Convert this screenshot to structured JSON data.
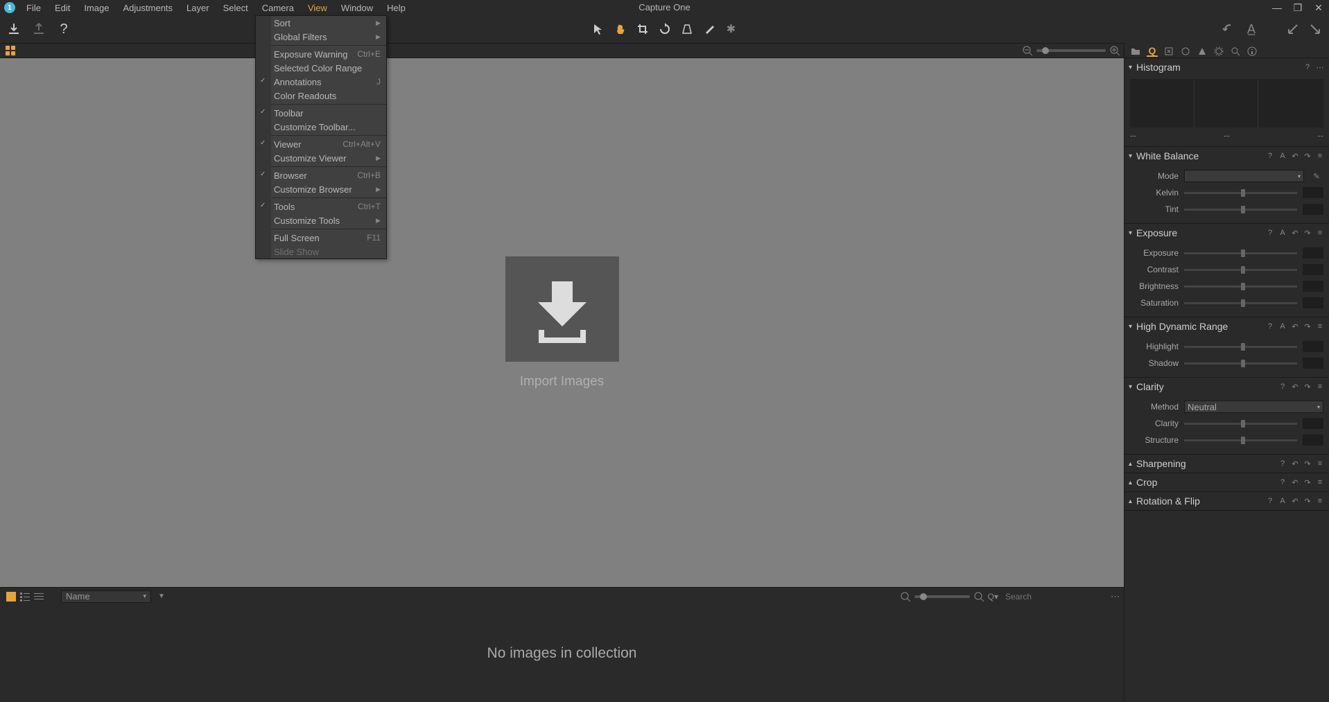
{
  "app": {
    "title": "Capture One"
  },
  "menubar": [
    "File",
    "Edit",
    "Image",
    "Adjustments",
    "Layer",
    "Select",
    "Camera",
    "View",
    "Window",
    "Help"
  ],
  "menubar_active": "View",
  "view_menu": [
    {
      "label": "Sort",
      "arrow": true
    },
    {
      "label": "Global Filters",
      "arrow": true
    },
    {
      "sep": true
    },
    {
      "label": "Exposure Warning",
      "shortcut": "Ctrl+E"
    },
    {
      "label": "Selected Color Range"
    },
    {
      "label": "Annotations",
      "shortcut": "J",
      "checked": true
    },
    {
      "label": "Color Readouts"
    },
    {
      "sep": true
    },
    {
      "label": "Toolbar",
      "checked": true
    },
    {
      "label": "Customize Toolbar..."
    },
    {
      "sep": true
    },
    {
      "label": "Viewer",
      "shortcut": "Ctrl+Alt+V",
      "checked": true
    },
    {
      "label": "Customize Viewer",
      "arrow": true
    },
    {
      "sep": true
    },
    {
      "label": "Browser",
      "shortcut": "Ctrl+B",
      "checked": true
    },
    {
      "label": "Customize Browser",
      "arrow": true
    },
    {
      "sep": true
    },
    {
      "label": "Tools",
      "shortcut": "Ctrl+T",
      "checked": true
    },
    {
      "label": "Customize Tools",
      "arrow": true
    },
    {
      "sep": true
    },
    {
      "label": "Full Screen",
      "shortcut": "F11"
    },
    {
      "label": "Slide Show",
      "disabled": true
    }
  ],
  "viewer": {
    "import_label": "Import Images"
  },
  "browser": {
    "sort_by": "Name",
    "search_placeholder": "Search",
    "empty": "No images in collection"
  },
  "panels": {
    "histogram": {
      "title": "Histogram",
      "v1": "--",
      "v2": "--",
      "v3": "--"
    },
    "white_balance": {
      "title": "White Balance",
      "mode": "Mode",
      "kelvin": "Kelvin",
      "tint": "Tint"
    },
    "exposure": {
      "title": "Exposure",
      "exposure": "Exposure",
      "contrast": "Contrast",
      "brightness": "Brightness",
      "saturation": "Saturation"
    },
    "hdr": {
      "title": "High Dynamic Range",
      "highlight": "Highlight",
      "shadow": "Shadow"
    },
    "clarity": {
      "title": "Clarity",
      "method": "Method",
      "method_val": "Neutral",
      "clarity": "Clarity",
      "structure": "Structure"
    },
    "sharpening": {
      "title": "Sharpening"
    },
    "crop": {
      "title": "Crop"
    },
    "rotation": {
      "title": "Rotation & Flip"
    }
  }
}
